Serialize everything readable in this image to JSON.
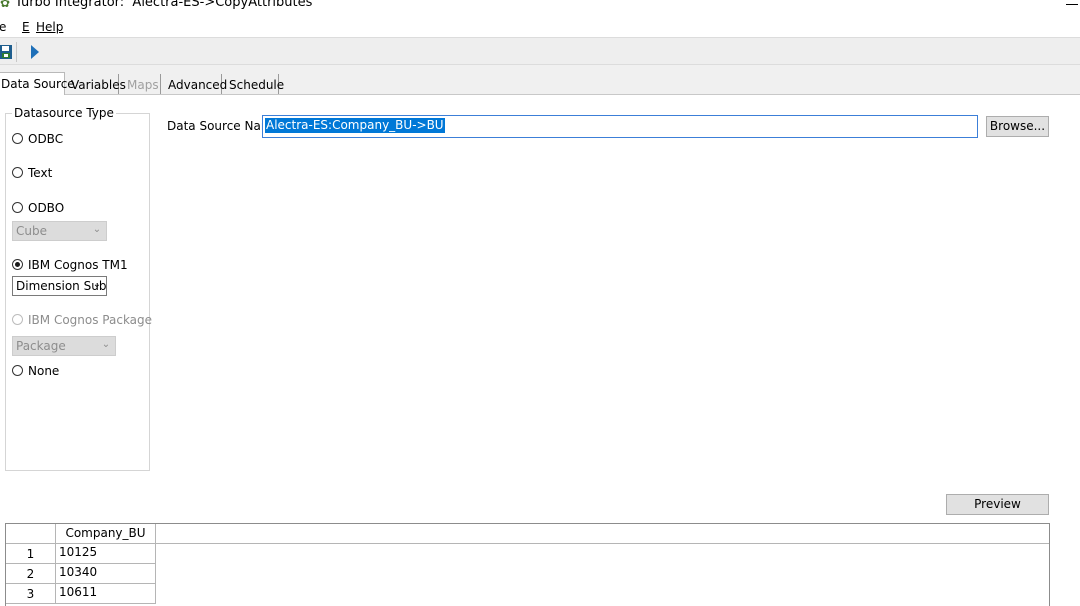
{
  "window": {
    "title": "Turbo Integrator:  Alectra-ES->CopyAttributes",
    "app_icon": "gear-icon"
  },
  "menu": {
    "items": [
      "e",
      "E",
      "Help"
    ]
  },
  "toolbar": {
    "buttons": [
      {
        "icon": "save-icon"
      },
      {
        "icon": "run-icon"
      }
    ]
  },
  "tabs": [
    {
      "label": "Data Source",
      "active": true,
      "enabled": true
    },
    {
      "label": "Variables",
      "active": false,
      "enabled": true
    },
    {
      "label": "Maps",
      "active": false,
      "enabled": false
    },
    {
      "label": "Advanced",
      "active": false,
      "enabled": true
    },
    {
      "label": "Schedule",
      "active": false,
      "enabled": true
    }
  ],
  "datasource_type": {
    "legend": "Datasource Type",
    "options": [
      {
        "label": "ODBC",
        "checked": false,
        "enabled": true
      },
      {
        "label": "Text",
        "checked": false,
        "enabled": true
      },
      {
        "label": "ODBO",
        "checked": false,
        "enabled": true
      },
      {
        "label": "IBM Cognos TM1",
        "checked": true,
        "enabled": true
      },
      {
        "label": "IBM Cognos Package",
        "checked": false,
        "enabled": false
      },
      {
        "label": "None",
        "checked": false,
        "enabled": true
      }
    ],
    "odbo_combo": "Cube",
    "tm1_combo": "Dimension Sub",
    "package_combo": "Package"
  },
  "data_source": {
    "name_label": "Data Source Name:",
    "name_value": "Alectra-ES:Company_BU->BU",
    "browse_label": "Browse..."
  },
  "preview_label": "Preview",
  "grid": {
    "columns": [
      "Company_BU"
    ],
    "rows": [
      {
        "num": "1",
        "value": "10125"
      },
      {
        "num": "2",
        "value": "10340"
      },
      {
        "num": "3",
        "value": "10611"
      }
    ]
  }
}
